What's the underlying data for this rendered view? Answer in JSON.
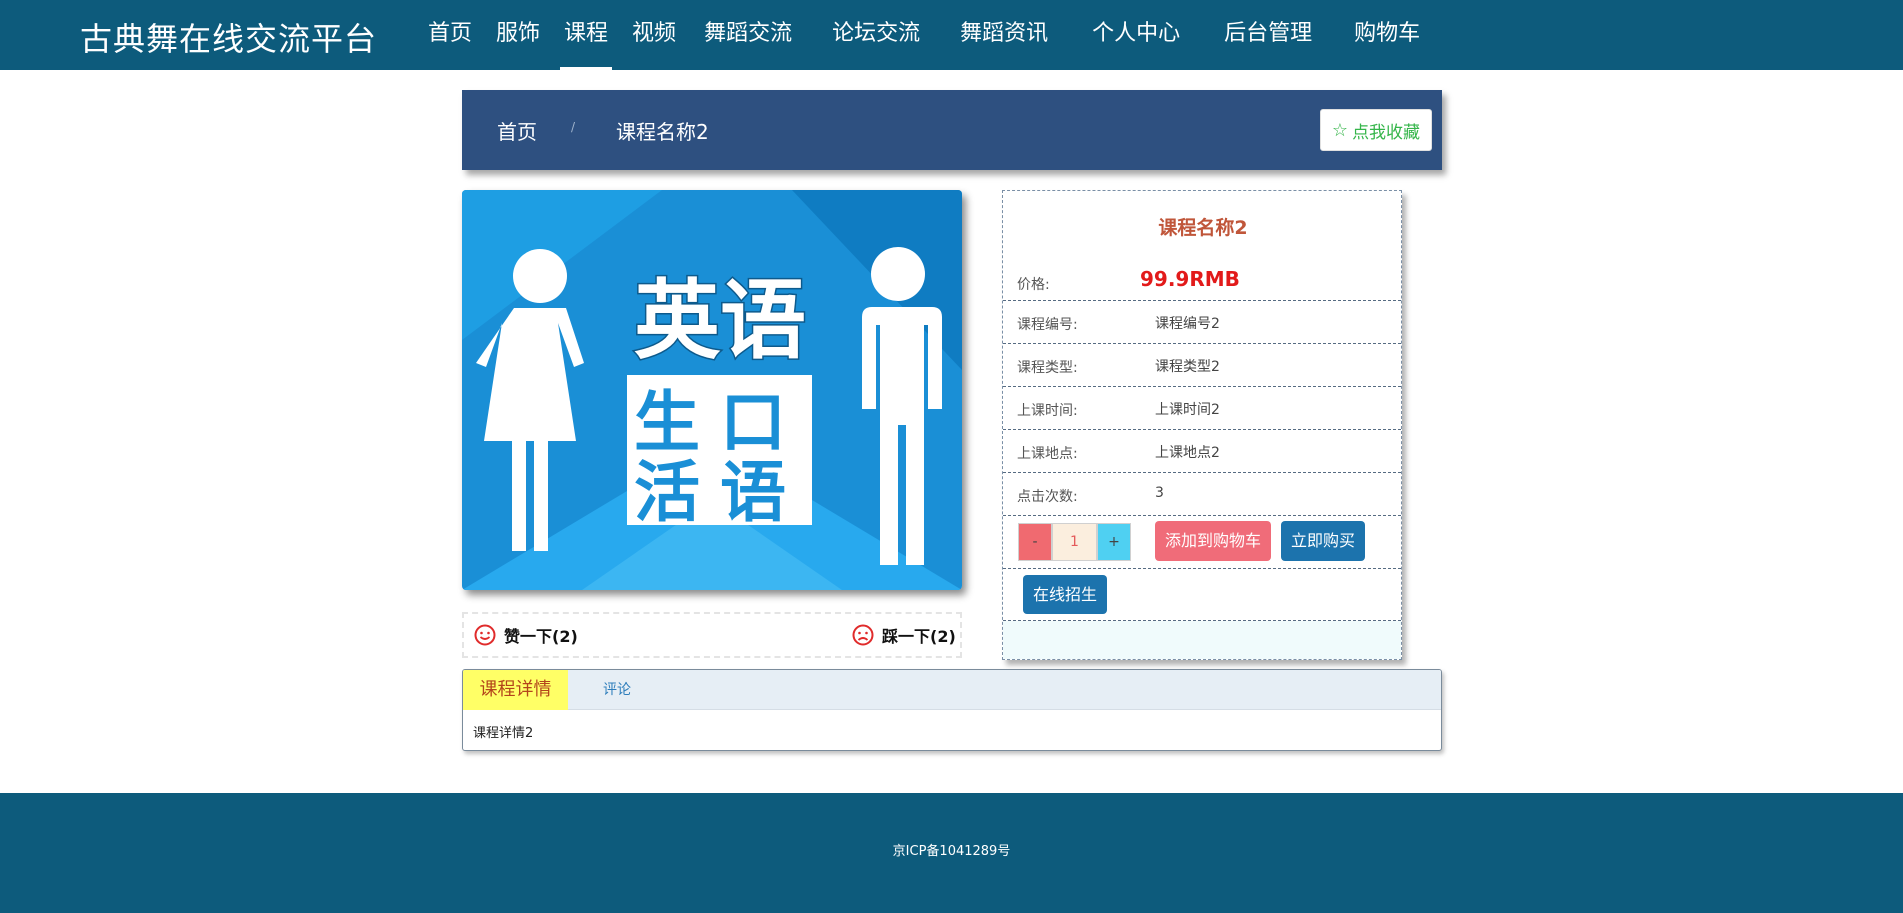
{
  "header": {
    "brand": "古典舞在线交流平台",
    "nav": [
      "首页",
      "服饰",
      "课程",
      "视频",
      "舞蹈交流",
      "论坛交流",
      "舞蹈资讯",
      "个人中心",
      "后台管理",
      "购物车"
    ],
    "active_nav": "课程"
  },
  "breadcrumb": {
    "home": "首页",
    "separator": "/",
    "current": "课程名称2",
    "favorite_label": "点我收藏"
  },
  "poster": {
    "title_text": "英语",
    "box_text": [
      "生口",
      "活语"
    ]
  },
  "votes": {
    "like": "赞一下(2)",
    "dislike": "踩一下(2)"
  },
  "course": {
    "title": "课程名称2",
    "price_label": "价格:",
    "price": "99.9RMB",
    "rows": [
      {
        "label": "课程编号:",
        "value": "课程编号2"
      },
      {
        "label": "课程类型:",
        "value": "课程类型2"
      },
      {
        "label": "上课时间:",
        "value": "上课时间2"
      },
      {
        "label": "上课地点:",
        "value": "上课地点2"
      },
      {
        "label": "点击次数:",
        "value": "3"
      }
    ],
    "qty_minus": "-",
    "qty_value": "1",
    "qty_plus": "+",
    "add_to_cart": "添加到购物车",
    "buy_now": "立即购买",
    "recruit": "在线招生"
  },
  "tabs": {
    "details": "课程详情",
    "comments": "评论",
    "details_content": "课程详情2"
  },
  "footer": {
    "icp": "京ICP备1041289号"
  },
  "colors": {
    "header_bg": "#0d5b7c",
    "crumb_bg": "#2e5080",
    "price": "#e21a1a",
    "primary_btn": "#1c73ad",
    "cart_btn": "#f06c79"
  }
}
